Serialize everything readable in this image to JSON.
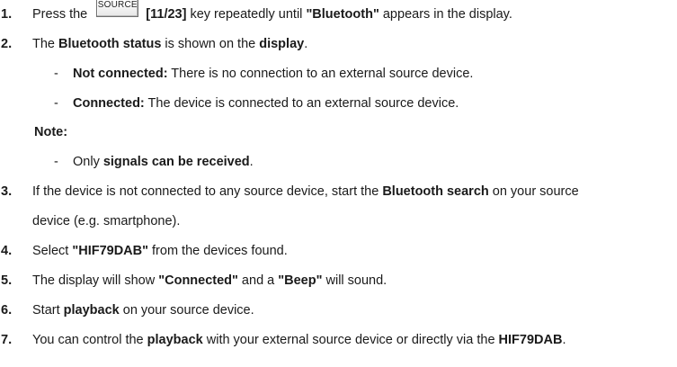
{
  "steps": {
    "s1": {
      "num": "1.",
      "a": "Press the ",
      "key_label": "SOURCE",
      "key_ref": "[11/23]",
      "b": " key repeatedly until ",
      "c": "\"Bluetooth\"",
      "d": " appears in the display."
    },
    "s2": {
      "num": "2.",
      "a": "The ",
      "b": "Bluetooth status",
      "c": " is shown on the ",
      "d": "display",
      "e": ".",
      "items": [
        {
          "dash": "-",
          "term": "Not connected:",
          "text": " There is no connection to an external source device."
        },
        {
          "dash": "-",
          "term": "Connected:",
          "text": " The device is connected to an external source device."
        }
      ],
      "note_label": "Note:",
      "note_item": {
        "dash": "-",
        "a": "Only ",
        "b": "signals can be received",
        "c": "."
      }
    },
    "s3": {
      "num": "3.",
      "a": "If the device is not connected to any source device, start the ",
      "b": "Bluetooth search",
      "c": " on your source",
      "line2": "device (e.g. smartphone)."
    },
    "s4": {
      "num": "4.",
      "a": "Select ",
      "b": "\"HIF79DAB\"",
      "c": " from the devices found."
    },
    "s5": {
      "num": "5.",
      "a": "The display will show ",
      "b": "\"Connected\"",
      "c": " and a ",
      "d": "\"Beep\"",
      "e": " will sound."
    },
    "s6": {
      "num": "6.",
      "a": "Start ",
      "b": "playback",
      "c": " on your source device."
    },
    "s7": {
      "num": "7.",
      "a": "You can control the ",
      "b": "playback",
      "c": " with your external source device or directly via the ",
      "d": "HIF79DAB",
      "e": "."
    }
  }
}
